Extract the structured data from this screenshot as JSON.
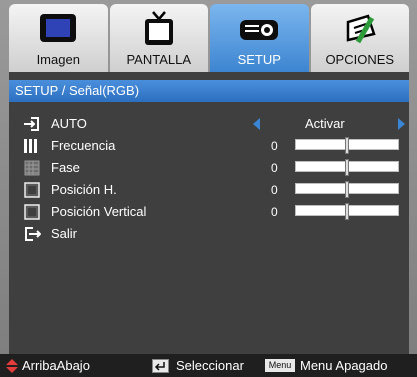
{
  "tabs": [
    {
      "label": "Imagen",
      "icon": "monitor-icon",
      "active": false
    },
    {
      "label": "PANTALLA",
      "icon": "tv-icon",
      "active": false
    },
    {
      "label": "SETUP",
      "icon": "projector-icon",
      "active": true
    },
    {
      "label": "OPCIONES",
      "icon": "options-icon",
      "active": false
    }
  ],
  "breadcrumb": "SETUP / Señal(RGB)",
  "menu": {
    "auto": {
      "label": "AUTO",
      "value": "Activar",
      "icon": "signal-in-icon"
    },
    "frecuencia": {
      "label": "Frecuencia",
      "value": "0",
      "icon": "bars-icon",
      "level": 0.5
    },
    "fase": {
      "label": "Fase",
      "value": "0",
      "icon": "grid-icon",
      "level": 0.5
    },
    "posh": {
      "label": "Posición H.",
      "value": "0",
      "icon": "square-icon",
      "level": 0.5
    },
    "posv": {
      "label": "Posición Vertical",
      "value": "0",
      "icon": "square2-icon",
      "level": 0.5
    },
    "salir": {
      "label": "Salir",
      "icon": "exit-icon"
    }
  },
  "status": {
    "nav_label": "ArribaAbajo",
    "select_label": "Seleccionar",
    "menu_key": "Menu",
    "menu_label": "Menu Apagado"
  },
  "colors": {
    "accent": "#3a86d6",
    "panel": "#3f3f3f",
    "active_tab": "#4b92dd"
  }
}
